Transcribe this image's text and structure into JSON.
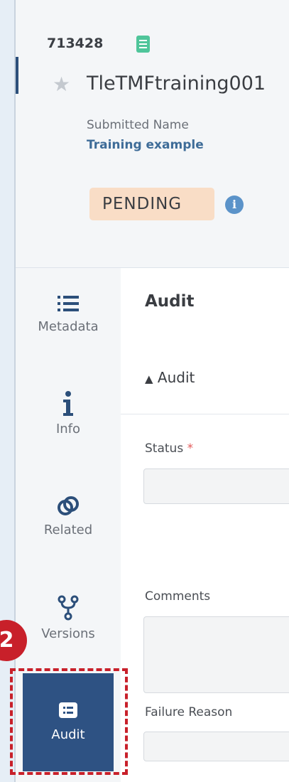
{
  "header": {
    "doc_id": "713428",
    "doc_icon": "document-icon",
    "title": "TleTMFtraining001",
    "submitted_name_label": "Submitted Name",
    "submitted_name_value": "Training example",
    "status": "PENDING",
    "status_info_icon": "info-icon"
  },
  "sidenav": {
    "items": [
      {
        "label": "Metadata",
        "icon": "list-icon"
      },
      {
        "label": "Info",
        "icon": "info-i-icon"
      },
      {
        "label": "Related",
        "icon": "link-icon"
      },
      {
        "label": "Versions",
        "icon": "branch-icon"
      },
      {
        "label": "Audit",
        "icon": "audit-icon",
        "active": true
      }
    ]
  },
  "main": {
    "section_title": "Audit",
    "toggle_label": "Audit",
    "fields": [
      {
        "label": "Status",
        "required": true,
        "value": ""
      },
      {
        "label": "Comments",
        "value": ""
      },
      {
        "label": "Failure Reason",
        "value": ""
      }
    ],
    "required_mark": "*"
  },
  "annotation": {
    "step_number": "2"
  },
  "colors": {
    "accent": "#2e5283",
    "status_badge": "#f9ddc6",
    "annotation": "#c8202a"
  }
}
